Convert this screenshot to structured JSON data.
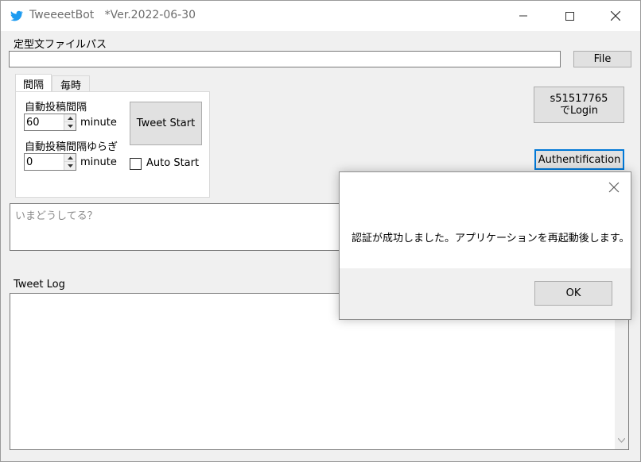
{
  "window": {
    "title": "TweeeetBot   *Ver.2022-06-30",
    "icon": "twitter-bird-icon",
    "accent": "#0078d7"
  },
  "form": {
    "template_path_label": "定型文ファイルパス",
    "template_path_value": "",
    "file_button": "File",
    "tabs": [
      "間隔",
      "毎時"
    ],
    "interval_label": "自動投稿間隔",
    "interval_value": "60",
    "interval_unit": "minute",
    "jitter_label": "自動投稿間隔ゆらぎ",
    "jitter_value": "0",
    "jitter_unit": "minute",
    "tweet_start_button": "Tweet Start",
    "auto_start_label": "Auto Start",
    "auto_start_checked": false,
    "login_button_line1": "s51517765",
    "login_button_line2": "でLogin",
    "auth_button": "Authentification",
    "tweet_placeholder": "いまどうしてる？",
    "tweet_log_label": "Tweet Log"
  },
  "dialog": {
    "message": "認証が成功しました。アプリケーションを再起動後します。",
    "ok_button": "OK"
  }
}
